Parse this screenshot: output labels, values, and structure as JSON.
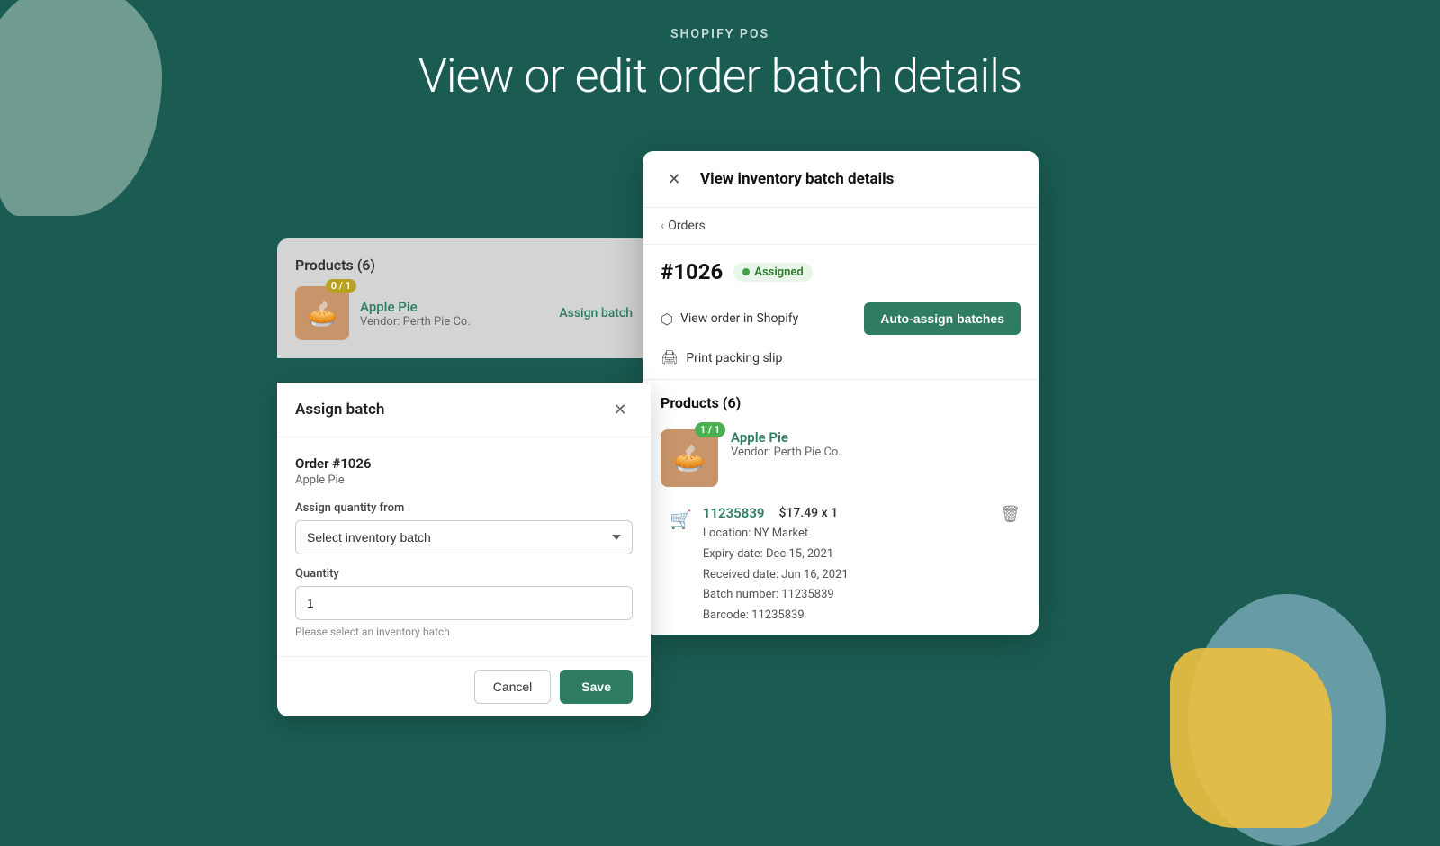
{
  "background": {
    "color": "#1a5c52"
  },
  "header": {
    "subtitle": "SHOPIFY POS",
    "title": "View or edit order batch details"
  },
  "products_card": {
    "title": "Products (6)",
    "badge": "0 / 1",
    "product_name": "Apple Pie",
    "vendor": "Vendor: Perth Pie Co.",
    "assign_batch_label": "Assign batch"
  },
  "assign_modal": {
    "title": "Assign batch",
    "order_ref": "Order #1026",
    "product_name": "Apple Pie",
    "assign_qty_label": "Assign quantity from",
    "select_placeholder": "Select inventory batch",
    "quantity_label": "Quantity",
    "quantity_value": "1",
    "hint": "Please select an inventory batch",
    "cancel_label": "Cancel",
    "save_label": "Save"
  },
  "inventory_panel": {
    "header_title": "View inventory batch details",
    "breadcrumb": "Orders",
    "order_number": "#1026",
    "status_badge": "Assigned",
    "view_order_label": "View order in Shopify",
    "auto_assign_label": "Auto-assign batches",
    "print_slip_label": "Print packing slip",
    "products_title": "Products (6)",
    "product_badge": "1 / 1",
    "product_name": "Apple Pie",
    "vendor": "Vendor: Perth Pie Co.",
    "batch_id": "11235839",
    "batch_price": "$17.49 x 1",
    "location": "Location: NY Market",
    "expiry": "Expiry date: Dec 15, 2021",
    "received": "Received date: Jun 16, 2021",
    "batch_number": "Batch number: 11235839",
    "barcode": "Barcode: 11235839"
  }
}
